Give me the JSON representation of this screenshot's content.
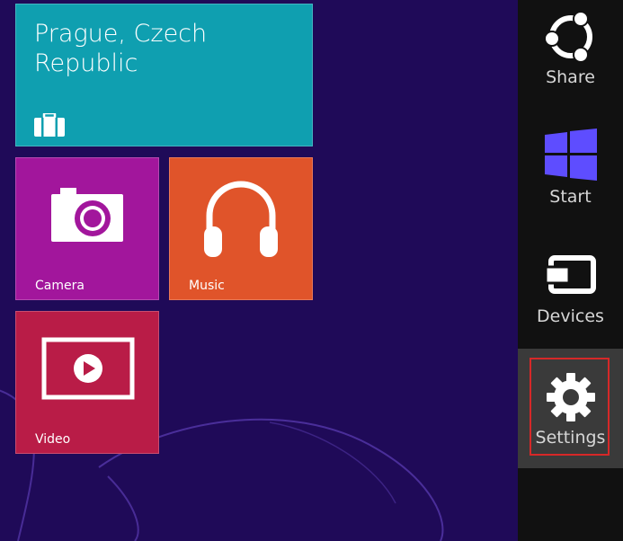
{
  "tiles": {
    "travel": {
      "city_line1": "Prague, Czech",
      "city_line2": "Republic",
      "color": "#0f9fb0"
    },
    "camera": {
      "label": "Camera",
      "color": "#a2169c"
    },
    "music": {
      "label": "Music",
      "color": "#e0542a"
    },
    "video": {
      "label": "Video",
      "color": "#b91c47"
    }
  },
  "charms": {
    "share": {
      "label": "Share",
      "icon": "share-icon"
    },
    "start": {
      "label": "Start",
      "icon": "windows-logo-icon",
      "accent": "#5e4dff"
    },
    "devices": {
      "label": "Devices",
      "icon": "devices-icon"
    },
    "settings": {
      "label": "Settings",
      "icon": "gear-icon",
      "highlight_color": "#d62828",
      "selected": true
    }
  },
  "colors": {
    "desktop_background": "#1f0a58",
    "charms_bar": "#111111",
    "charm_hover": "#3a3a3a"
  }
}
